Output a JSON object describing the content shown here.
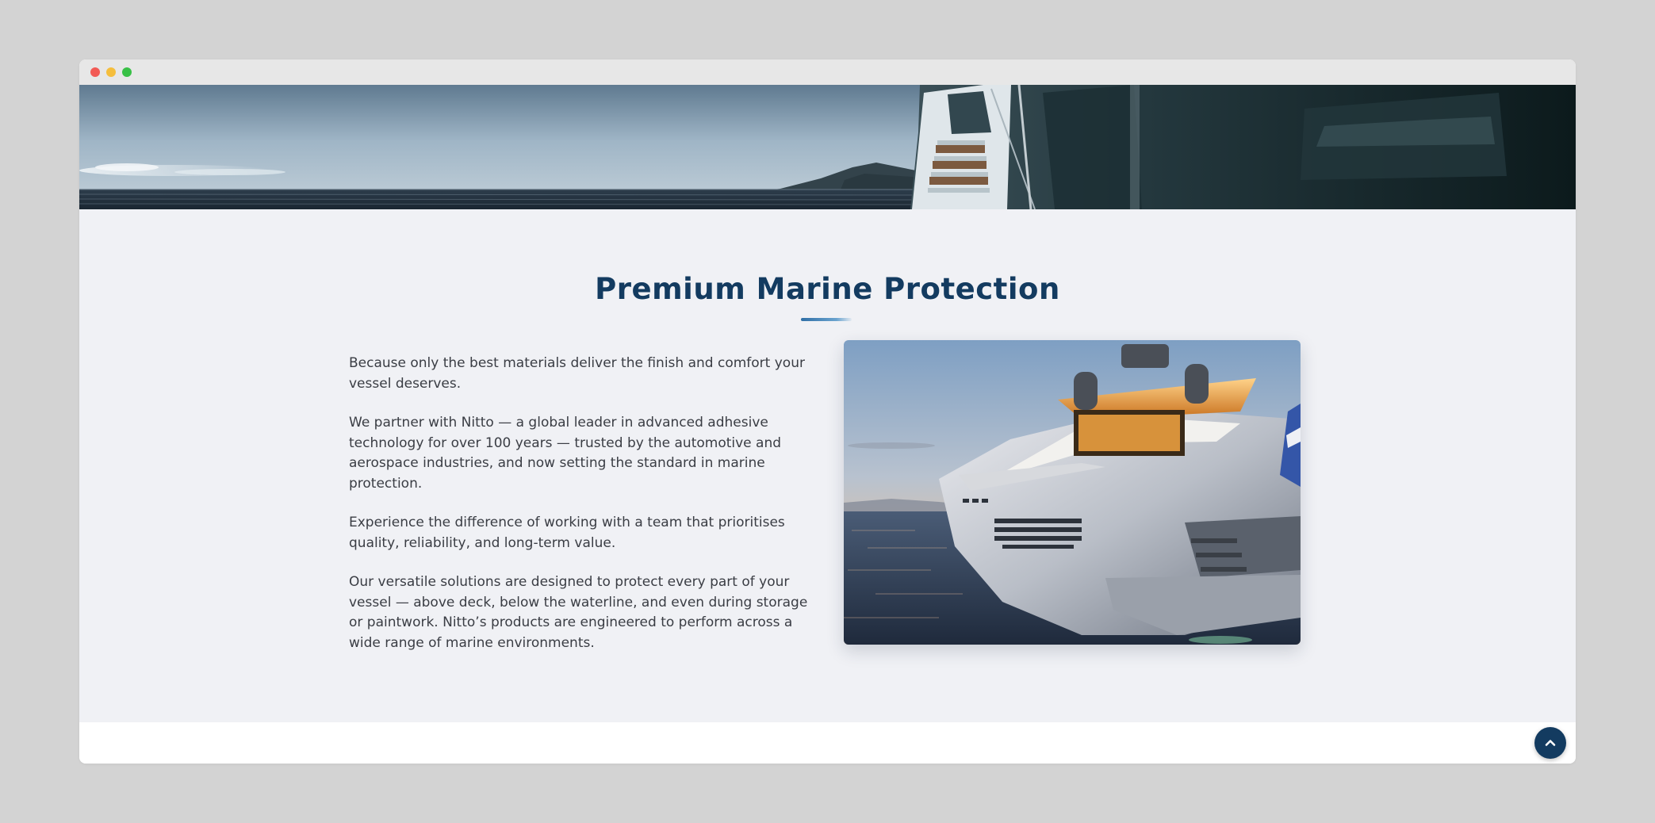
{
  "window": {
    "controls": [
      "close",
      "minimize",
      "maximize"
    ]
  },
  "hero": {
    "image": "yacht-deck-sea-banner"
  },
  "section": {
    "title": "Premium Marine Protection",
    "paragraphs": [
      "Because only the best materials deliver the finish and comfort your vessel deserves.",
      "We partner with Nitto — a global leader in advanced adhesive technology for over 100 years — trusted by the automotive and aerospace industries, and now setting the standard in marine protection.",
      "Experience the difference of working with a team that prioritises quality, reliability, and long-term value.",
      "Our versatile solutions are designed to protect every part of your vessel — above deck, below the waterline, and even during storage or paintwork. Nitto’s products are engineered to perform across a wide range of marine environments."
    ],
    "image": "luxury-yacht-sunset"
  },
  "scroll_top": {
    "icon": "chevron-up-icon"
  },
  "colors": {
    "page_bg": "#d3d3d3",
    "titlebar": "#e7e7e7",
    "content_bg": "#f0f1f5",
    "heading": "#133b60",
    "body_text": "#3a3d44",
    "accent": "#2f6fa6",
    "scroll_button": "#133b60"
  }
}
